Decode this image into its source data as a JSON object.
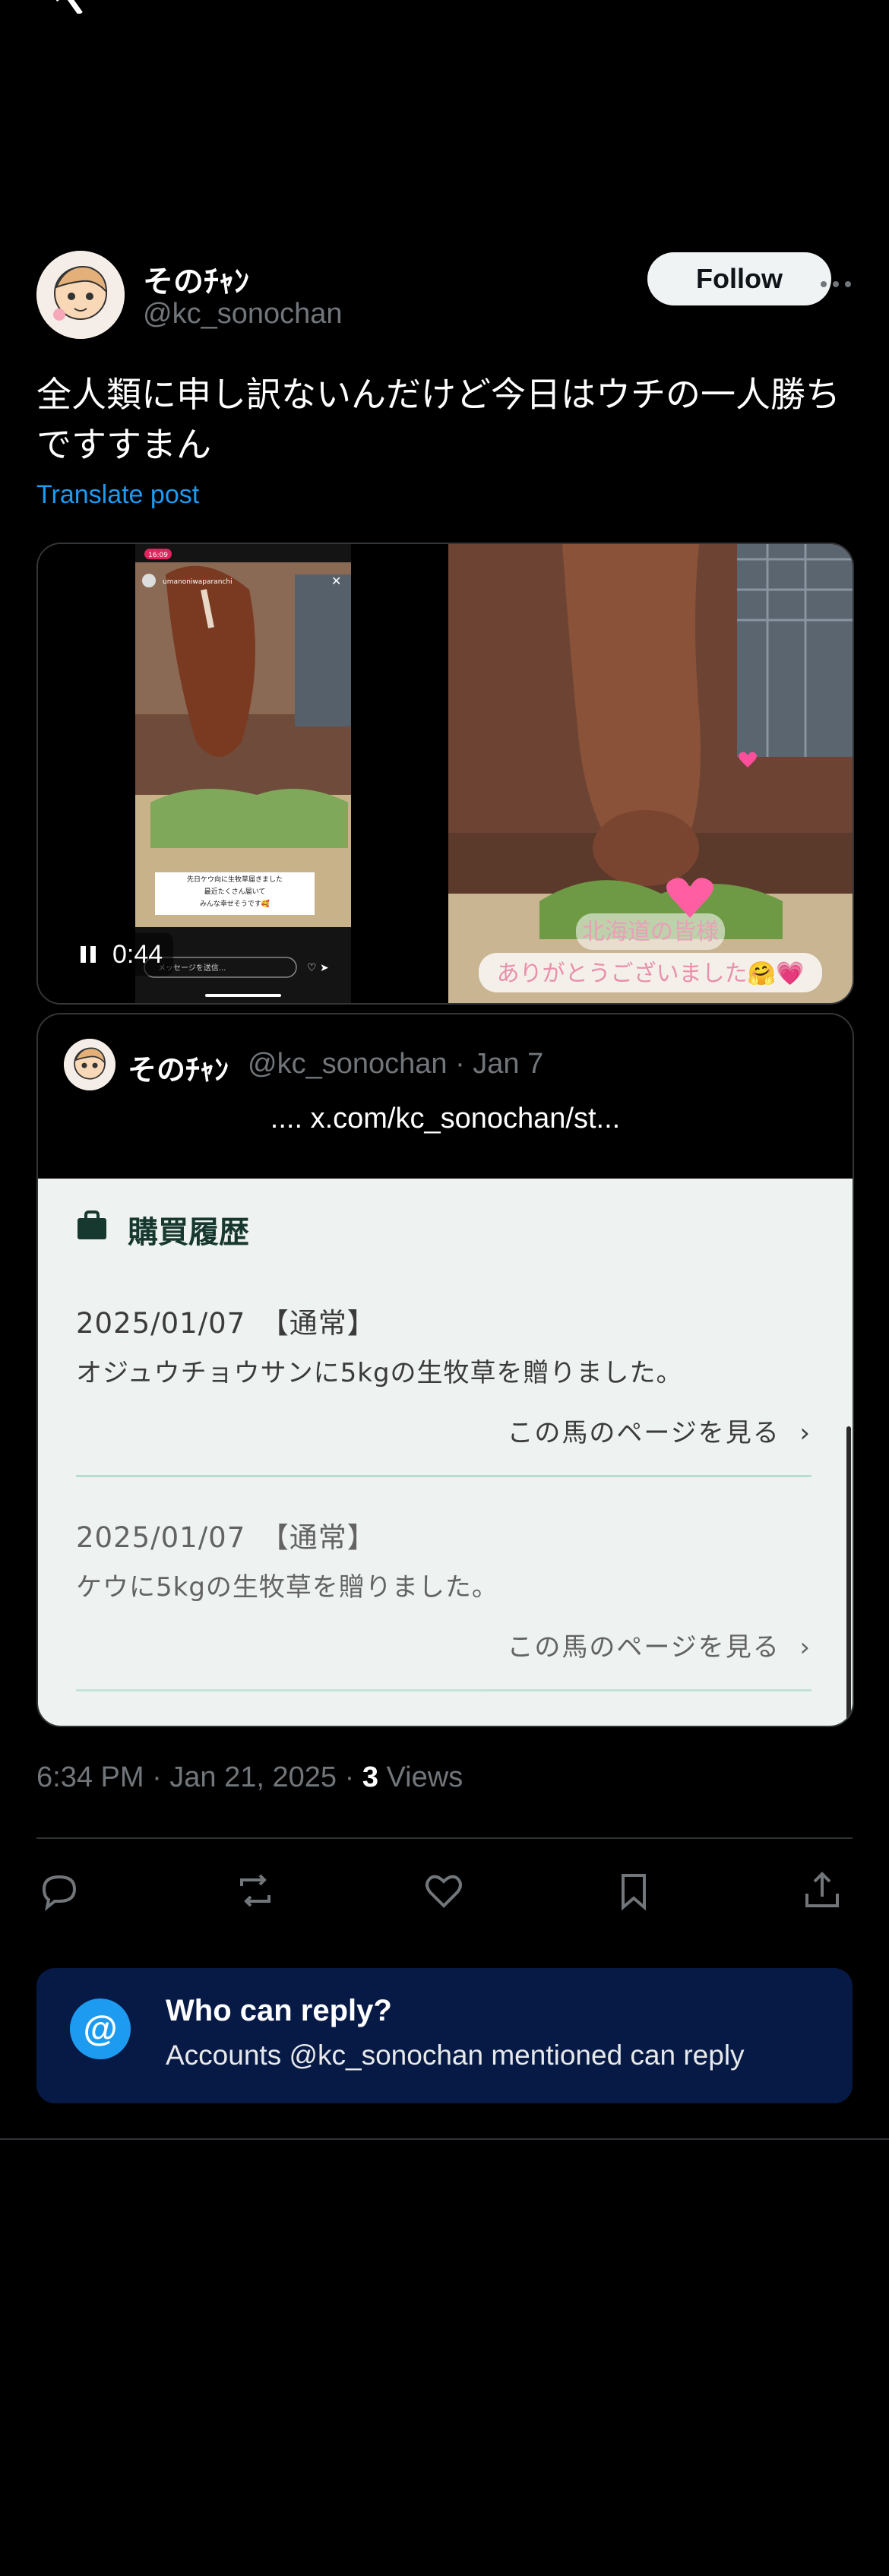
{
  "app": {
    "logo_icon": "x-logo-icon"
  },
  "post": {
    "author_name": "そのﾁｬﾝ",
    "author_handle": "@kc_sonochan",
    "follow_label": "Follow",
    "text": "全人類に申し訳ないんだけど今日はウチの一人勝ちですすまん",
    "translate_label": "Translate post",
    "video": {
      "duration": "0:44",
      "phone_time": "16:09",
      "phone_user": "umanoniwaparanchi",
      "phone_caption": "先日ケウ向に生牧草届きました\n最近たくさん届いて\nみんな幸せそうです🥰",
      "phone_input": "メッセージを送信...",
      "overlay_line1": "北海道の皆様",
      "overlay_line2": "ありがとうございました🤗💗"
    },
    "timestamp": "6:34 PM · Jan 21, 2025",
    "views_count": "3",
    "views_label": "Views"
  },
  "quote": {
    "author_name": "そのﾁｬﾝ",
    "author_handle": "@kc_sonochan · Jan 7",
    "link_text": "....  x.com/kc_sonochan/st...",
    "panel_title": "購買履歴",
    "records": [
      {
        "date": "2025/01/07　【通常】",
        "desc": "オジュウチョウサンに5kgの生牧草を贈りました。",
        "link": "この馬のページを見る"
      },
      {
        "date": "2025/01/07　【通常】",
        "desc": "ケウに5kgの生牧草を贈りました。",
        "link": "この馬のページを見る"
      }
    ]
  },
  "reply_restriction": {
    "title": "Who can reply?",
    "subtitle": "Accounts @kc_sonochan mentioned can reply"
  },
  "colors": {
    "accent": "#1d9bf0",
    "reply_box_bg": "#071a45",
    "panel_bg": "#eef3f1",
    "panel_title": "#17382e"
  }
}
